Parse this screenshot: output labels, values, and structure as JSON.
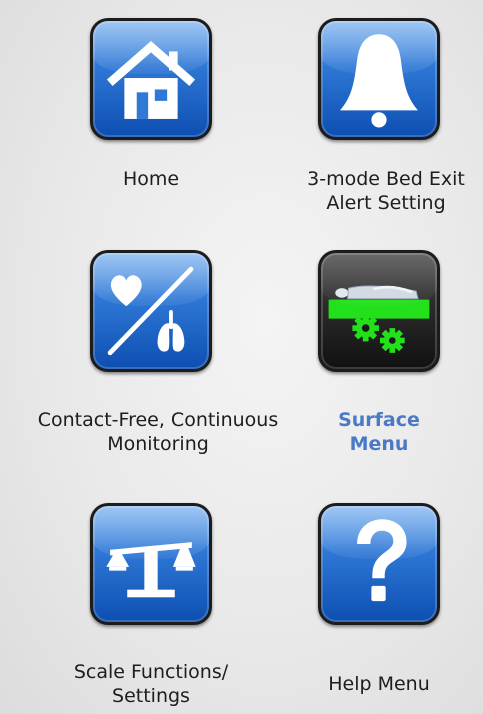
{
  "menu": {
    "items": [
      {
        "label_line1": "Home",
        "label_line2": "",
        "icon": "house-icon",
        "active": false
      },
      {
        "label_line1": "3-mode Bed Exit",
        "label_line2": "Alert Setting",
        "icon": "bell-icon",
        "active": false
      },
      {
        "label_line1": "Contact-Free, Continuous",
        "label_line2": "Monitoring",
        "icon": "heart-lungs-icon",
        "active": false
      },
      {
        "label_line1": "Surface",
        "label_line2": "Menu",
        "icon": "surface-bed-gears-icon",
        "active": true
      },
      {
        "label_line1": "Scale Functions/",
        "label_line2": "Settings",
        "icon": "scale-icon",
        "active": false
      },
      {
        "label_line1": "Help Menu",
        "label_line2": "",
        "icon": "question-mark-icon",
        "active": false
      }
    ]
  },
  "colors": {
    "tile_blue": "#2f78d6",
    "tile_dark": "#2b2b2b",
    "surface_green": "#22e01a",
    "active_label": "#4a79c6"
  }
}
